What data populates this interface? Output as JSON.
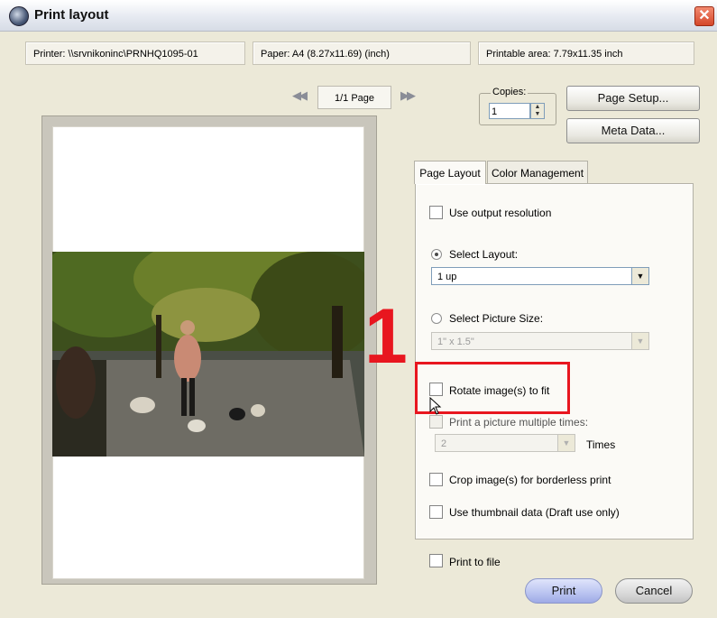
{
  "window": {
    "title": "Print layout",
    "close_glyph": "✕"
  },
  "info": {
    "printer": "Printer:  \\\\srvnikoninc\\PRNHQ1095-01",
    "paper": "Paper:  A4 (8.27x11.69) (inch)",
    "printable": "Printable area:  7.79x11.35 inch"
  },
  "pager": {
    "label": "1/1 Page",
    "prev_glyph": "◀◀",
    "next_glyph": "▶▶"
  },
  "copies": {
    "label": "Copies:",
    "value": "1"
  },
  "buttons": {
    "page_setup": "Page Setup...",
    "meta_data": "Meta Data...",
    "print": "Print",
    "cancel": "Cancel"
  },
  "tabs": [
    {
      "label": "Page Layout",
      "active": true
    },
    {
      "label": "Color Management",
      "active": false
    }
  ],
  "options": {
    "use_output_resolution": "Use output resolution",
    "select_layout": "Select Layout:",
    "layout_value": "1 up",
    "select_picture_size": "Select Picture Size:",
    "picture_size_value": "1\" x 1.5\"",
    "rotate_images": "Rotate image(s) to fit",
    "print_multiple": "Print a picture multiple times:",
    "times_value": "2",
    "times_label": "Times",
    "crop_borderless": "Crop image(s) for borderless print",
    "use_thumbnail": "Use thumbnail data (Draft use only)",
    "print_to_file": "Print to file"
  },
  "annotation": {
    "number": "1",
    "color": "#e8161f"
  },
  "colors": {
    "window_bg": "#ece9d8",
    "print_button": "#b9c3f0",
    "cancel_button": "#d9d9d9"
  }
}
